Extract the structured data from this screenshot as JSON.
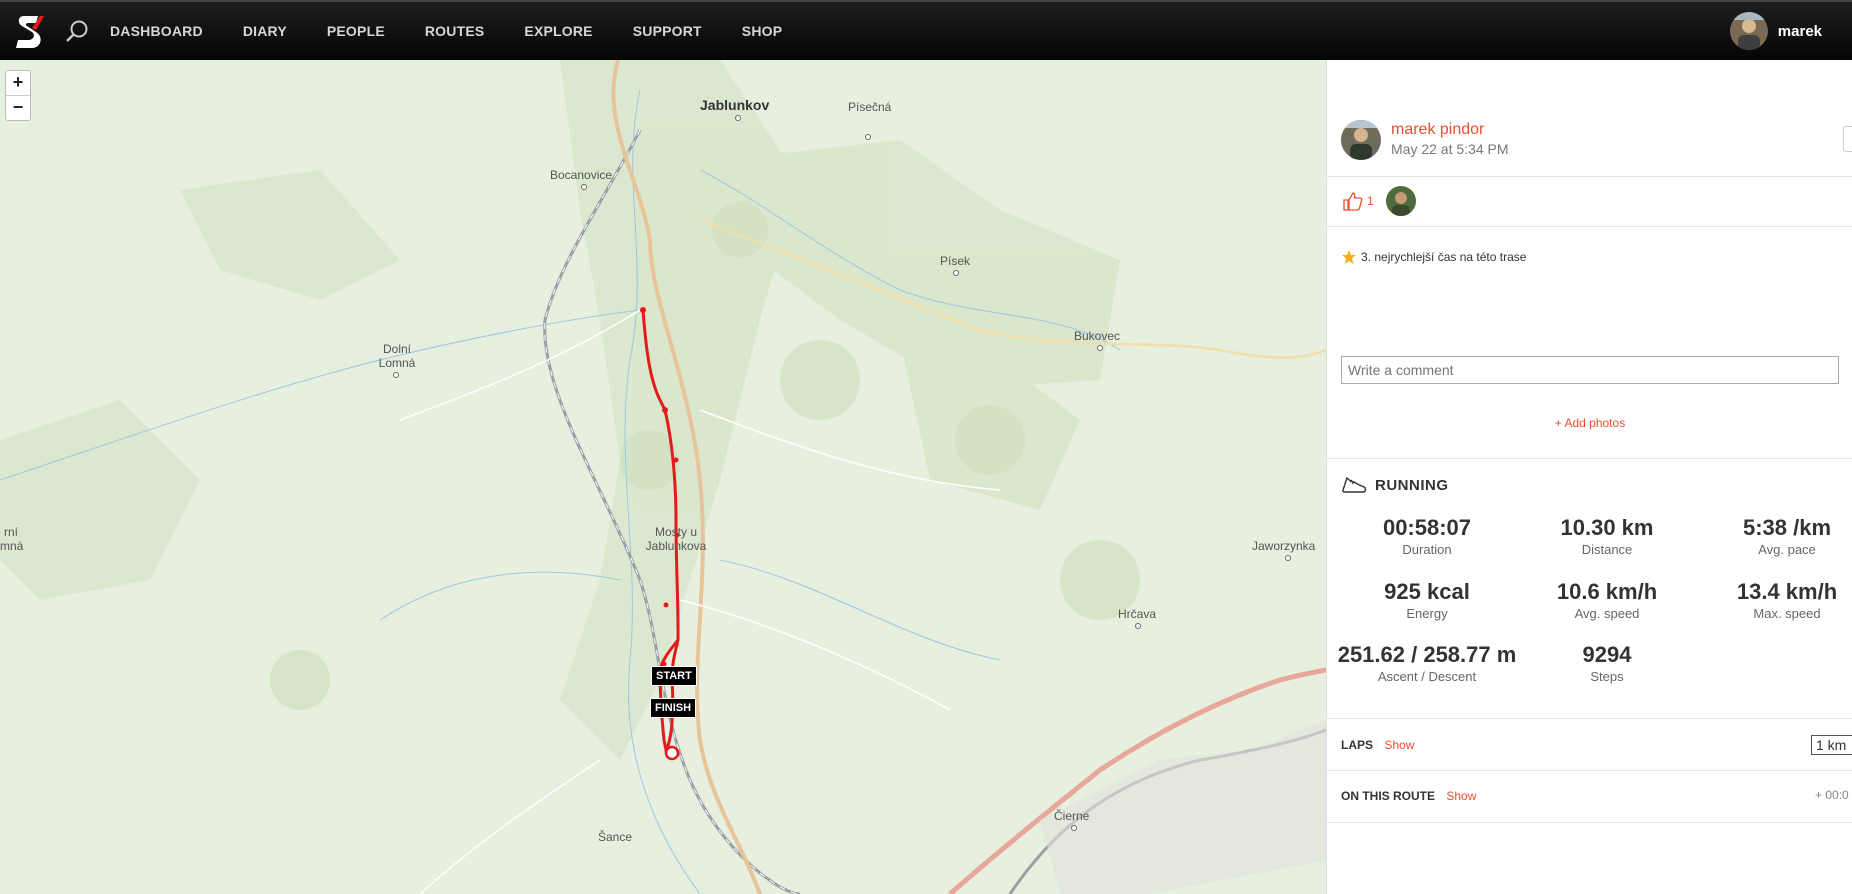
{
  "nav": {
    "logo_icon": "brand-s-logo-icon",
    "search_icon": "search-icon",
    "items": [
      {
        "label": "DASHBOARD"
      },
      {
        "label": "DIARY"
      },
      {
        "label": "PEOPLE"
      },
      {
        "label": "ROUTES"
      },
      {
        "label": "EXPLORE"
      },
      {
        "label": "SUPPORT"
      },
      {
        "label": "SHOP"
      }
    ],
    "user_name": "marek"
  },
  "map": {
    "zoom_in": "+",
    "zoom_out": "−",
    "places": [
      {
        "name": "Jablunkov"
      },
      {
        "name": "Písečná"
      },
      {
        "name": "Bocanovice"
      },
      {
        "name": "Písek"
      },
      {
        "name": "Dolní Lomná"
      },
      {
        "name": "Bukovec"
      },
      {
        "name": "Mosty u Jablunkova"
      },
      {
        "name": "Jaworzynka"
      },
      {
        "name": "Hrčava"
      },
      {
        "name": "rní mná"
      },
      {
        "name": "Čierne"
      },
      {
        "name": "Šance"
      }
    ],
    "start_label": "START",
    "finish_label": "FINISH",
    "route_color": "#e31b1b"
  },
  "activity": {
    "author": "marek pindor",
    "date": "May 22 at 5:34 PM",
    "likes": "1",
    "achievement": "3. nejrychlejší čas na této trase",
    "comment_placeholder": "Write a comment",
    "add_photos": "+ Add photos",
    "type": "RUNNING",
    "stats": [
      {
        "value": "00:58:07",
        "label": "Duration"
      },
      {
        "value": "10.30 km",
        "label": "Distance"
      },
      {
        "value": "5:38 /km",
        "label": "Avg. pace"
      },
      {
        "value": "925 kcal",
        "label": "Energy"
      },
      {
        "value": "10.6 km/h",
        "label": "Avg. speed"
      },
      {
        "value": "13.4 km/h",
        "label": "Max. speed"
      },
      {
        "value": "251.62 / 258.77 m",
        "label": "Ascent / Descent"
      },
      {
        "value": "9294",
        "label": "Steps"
      }
    ],
    "laps_label": "LAPS",
    "laps_show": "Show",
    "laps_select": "1 km",
    "route_label": "ON THIS ROUTE",
    "route_show": "Show",
    "route_extra": "+ 00:0"
  },
  "colors": {
    "accent": "#e8502f",
    "map_bg": "#e7efde"
  }
}
